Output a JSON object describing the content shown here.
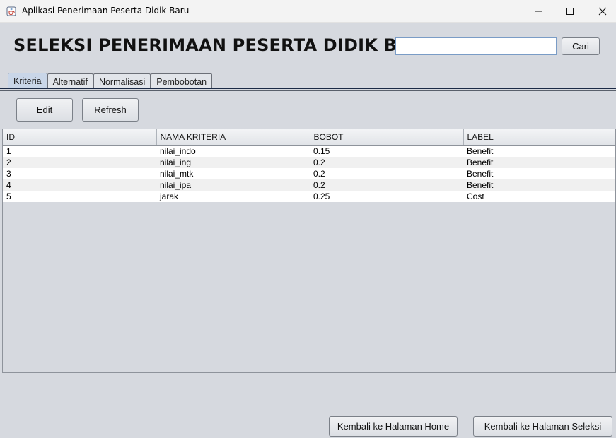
{
  "window": {
    "title": "Aplikasi Penerimaan Peserta Didik Baru",
    "icon": "java-cup-icon",
    "controls": [
      "minimize-icon",
      "maximize-icon",
      "close-icon"
    ]
  },
  "header": {
    "heading": "SELEKSI PENERIMAAN PESERTA DIDIK BARU",
    "search_value": "",
    "search_placeholder": "",
    "search_button": "Cari"
  },
  "tabs": [
    {
      "label": "Kriteria",
      "active": true
    },
    {
      "label": "Alternatif",
      "active": false
    },
    {
      "label": "Normalisasi",
      "active": false
    },
    {
      "label": "Pembobotan",
      "active": false
    }
  ],
  "toolbar": {
    "edit_label": "Edit",
    "refresh_label": "Refresh"
  },
  "table": {
    "columns": [
      "ID",
      "NAMA KRITERIA",
      "BOBOT",
      "LABEL"
    ],
    "rows": [
      [
        "1",
        "nilai_indo",
        "0.15",
        "Benefit"
      ],
      [
        "2",
        "nilai_ing",
        "0.2",
        "Benefit"
      ],
      [
        "3",
        "nilai_mtk",
        "0.2",
        "Benefit"
      ],
      [
        "4",
        "nilai_ipa",
        "0.2",
        "Benefit"
      ],
      [
        "5",
        "jarak",
        "0.25",
        "Cost"
      ]
    ]
  },
  "footer": {
    "home_button": "Kembali ke Halaman Home",
    "seleksi_button": "Kembali ke Halaman Seleksi"
  },
  "colors": {
    "background": "#d6d9df",
    "active_tab": "#c9d6e8",
    "search_border": "#7a9cc6"
  }
}
